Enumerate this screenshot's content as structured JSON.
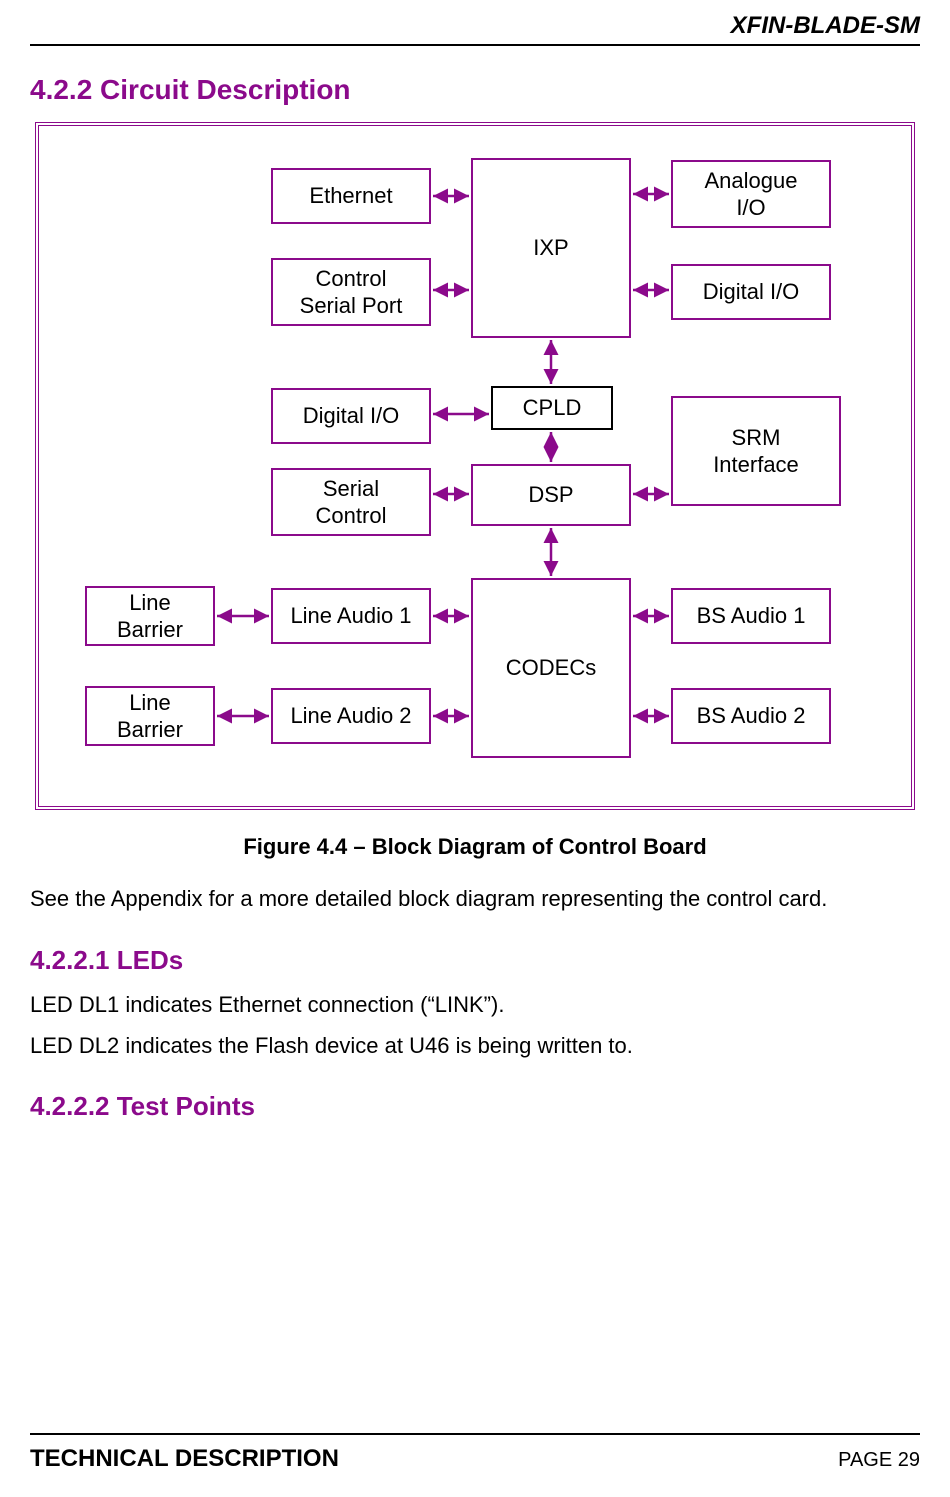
{
  "header": {
    "product": "XFIN-BLADE-SM"
  },
  "section": {
    "number_title": "4.2.2 Circuit Description"
  },
  "diagram": {
    "ethernet": "Ethernet",
    "control_serial_port": "Control\nSerial Port",
    "ixp": "IXP",
    "analogue_io": "Analogue\nI/O",
    "digital_io_right": "Digital I/O",
    "digital_io_left": "Digital I/O",
    "cpld": "CPLD",
    "srm_interface": "SRM\nInterface",
    "serial_control": "Serial\nControl",
    "dsp": "DSP",
    "line_barrier_1": "Line\nBarrier",
    "line_barrier_2": "Line\nBarrier",
    "line_audio_1": "Line Audio 1",
    "line_audio_2": "Line Audio 2",
    "codecs": "CODECs",
    "bs_audio_1": "BS Audio 1",
    "bs_audio_2": "BS Audio 2"
  },
  "figure": {
    "caption": "Figure 4.4 – Block Diagram of Control Board"
  },
  "body": {
    "appendix_ref": "See the Appendix for a more detailed block diagram representing the control card.",
    "leds_heading": "4.2.2.1 LEDs",
    "led_dl1": "LED DL1 indicates Ethernet connection (“LINK”).",
    "led_dl2": "LED DL2 indicates the Flash device at U46 is being written to.",
    "test_points_heading": "4.2.2.2 Test Points"
  },
  "footer": {
    "left": "TECHNICAL DESCRIPTION",
    "right": "PAGE 29"
  }
}
